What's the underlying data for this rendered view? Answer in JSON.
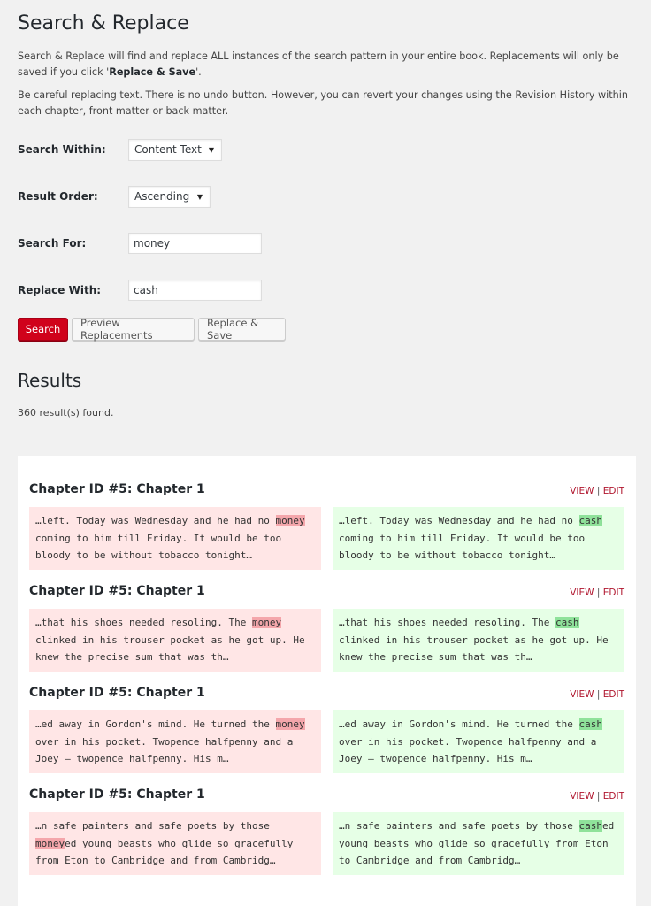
{
  "page": {
    "title": "Search & Replace",
    "desc1_before": "Search & Replace will find and replace ALL instances of the search pattern in your entire book. Replacements will only be saved if you click '",
    "desc1_strong": "Replace & Save",
    "desc1_after": "'.",
    "desc2": "Be careful replacing text. There is no undo button. However, you can revert your changes using the Revision History within each chapter, front matter or back matter."
  },
  "form": {
    "search_within_label": "Search Within:",
    "search_within_value": "Content Text",
    "result_order_label": "Result Order:",
    "result_order_value": "Ascending",
    "search_for_label": "Search For:",
    "search_for_value": "money",
    "replace_with_label": "Replace With:",
    "replace_with_value": "cash"
  },
  "buttons": {
    "search": "Search",
    "preview": "Preview Replacements",
    "replace_save": "Replace & Save"
  },
  "results": {
    "title": "Results",
    "count": "360 result(s) found.",
    "view_label": "VIEW",
    "separator": "|",
    "edit_label": "EDIT",
    "items": [
      {
        "title": "Chapter ID #5: Chapter 1",
        "old_before": "…left. Today was Wednesday and he had no ",
        "old_match": "money",
        "old_after": " coming to him till Friday. It would be too bloody to be without tobacco tonight…",
        "new_before": "…left. Today was Wednesday and he had no ",
        "new_match": "cash",
        "new_after": " coming to him till Friday. It would be too bloody to be without tobacco tonight…"
      },
      {
        "title": "Chapter ID #5: Chapter 1",
        "old_before": "…that his shoes needed resoling. The ",
        "old_match": "money",
        "old_after": " clinked in his trouser pocket as he got up. He knew the precise sum that was th…",
        "new_before": "…that his shoes needed resoling. The ",
        "new_match": "cash",
        "new_after": " clinked in his trouser pocket as he got up. He knew the precise sum that was th…"
      },
      {
        "title": "Chapter ID #5: Chapter 1",
        "old_before": "…ed away in Gordon's mind. He turned the ",
        "old_match": "money",
        "old_after": " over in his pocket. Twopence halfpenny and a Joey — twopence halfpenny. His m…",
        "new_before": "…ed away in Gordon's mind. He turned the ",
        "new_match": "cash",
        "new_after": " over in his pocket. Twopence halfpenny and a Joey — twopence halfpenny. His m…"
      },
      {
        "title": "Chapter ID #5: Chapter 1",
        "old_before": "…n safe painters and safe poets by those ",
        "old_match": "money",
        "old_after": "ed young beasts who glide so gracefully from Eton to Cambridge and from Cambridg…",
        "new_before": "…n safe painters and safe poets by those ",
        "new_match": "cash",
        "new_after": "ed young beasts who glide so gracefully from Eton to Cambridge and from Cambridg…"
      }
    ]
  },
  "colors": {
    "primary_button": "#d0021b",
    "removed_bg": "#ffe6e6",
    "added_bg": "#e6ffe6",
    "removed_highlight": "#f4a6ab",
    "added_highlight": "#8fe29a",
    "link": "#b0162e"
  }
}
